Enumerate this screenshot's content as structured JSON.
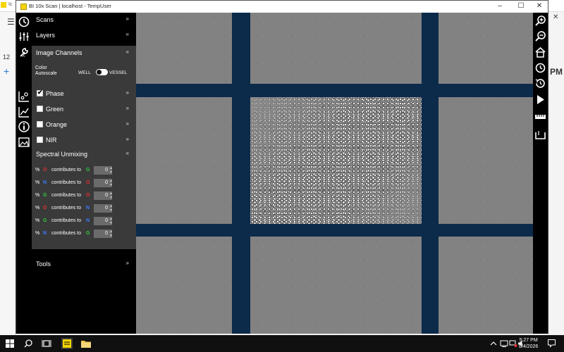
{
  "background_app": {
    "title": "Ic",
    "number": "12",
    "pm": "PM"
  },
  "window": {
    "title": "BI 10x Scan | localhost - TempUser",
    "min": "–",
    "max": "☐",
    "close": "✕"
  },
  "panel": {
    "scans": "Scans",
    "layers": "Layers",
    "image_channels": "Image Channels",
    "color_autoscale": "Color Autoscale",
    "well": "WELL",
    "vessel": "VESSEL",
    "channels": [
      {
        "label": "Phase",
        "checked": true
      },
      {
        "label": "Green",
        "checked": false
      },
      {
        "label": "Orange",
        "checked": false
      },
      {
        "label": "NIR",
        "checked": false
      }
    ],
    "spectral_unmixing": "Spectral Unmixing",
    "unmixing_rows": [
      {
        "pct": "%",
        "a": "O",
        "a_color": "#e23030",
        "text": "contributes to",
        "b": "G",
        "b_color": "#2ecc40",
        "value": "0"
      },
      {
        "pct": "%",
        "a": "N",
        "a_color": "#3b7bff",
        "text": "contributes to",
        "b": "O",
        "b_color": "#e23030",
        "value": "0"
      },
      {
        "pct": "%",
        "a": "G",
        "a_color": "#2ecc40",
        "text": "contributes to",
        "b": "O",
        "b_color": "#e23030",
        "value": "0"
      },
      {
        "pct": "%",
        "a": "O",
        "a_color": "#e23030",
        "text": "contributes to",
        "b": "N",
        "b_color": "#3b7bff",
        "value": "0"
      },
      {
        "pct": "%",
        "a": "G",
        "a_color": "#2ecc40",
        "text": "contributes to",
        "b": "N",
        "b_color": "#3b7bff",
        "value": "0"
      },
      {
        "pct": "%",
        "a": "N",
        "a_color": "#3b7bff",
        "text": "contributes to",
        "b": "G",
        "b_color": "#2ecc40",
        "value": "0"
      }
    ],
    "tools": "Tools",
    "collapse_glyph": "«",
    "chevron_down": "»",
    "chevron_up": "«"
  },
  "taskbar": {
    "time": "5:27 PM",
    "date": "8/4/2026"
  },
  "colors": {
    "map_background": "#0c2a4a",
    "panel_sub": "#3a3a3a",
    "app_icon": "#f5d400"
  }
}
